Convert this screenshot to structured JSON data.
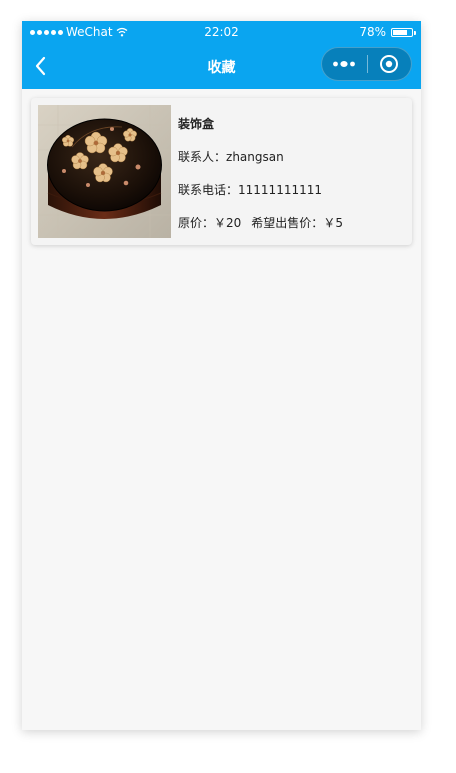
{
  "status_bar": {
    "carrier": "WeChat",
    "time": "22:02",
    "battery_percent_text": "78%",
    "battery_level": 0.78,
    "signal_dots": 5,
    "icons": [
      "signal-dots-icon",
      "wifi-icon",
      "battery-icon"
    ]
  },
  "nav": {
    "title": "收藏",
    "back_icon": "chevron-left-icon",
    "more_icon": "more-dots-icon",
    "close_icon": "target-circle-icon"
  },
  "colors": {
    "nav_bg": "#0aa5f0",
    "page_bg": "#f7f7f7",
    "card_bg": "#f4f4f4",
    "text": "#222222"
  },
  "favorites": [
    {
      "title": "装饰盒",
      "contact_label": "联系人：",
      "contact_value": "zhangsan",
      "phone_label": "联系电话：",
      "phone_value": "11111111111",
      "original_price_label": "原价：",
      "original_price_value": "￥20",
      "sale_price_label": "希望出售价：",
      "sale_price_value": "￥5",
      "image": "lacquer-box-with-flowers-image"
    }
  ]
}
